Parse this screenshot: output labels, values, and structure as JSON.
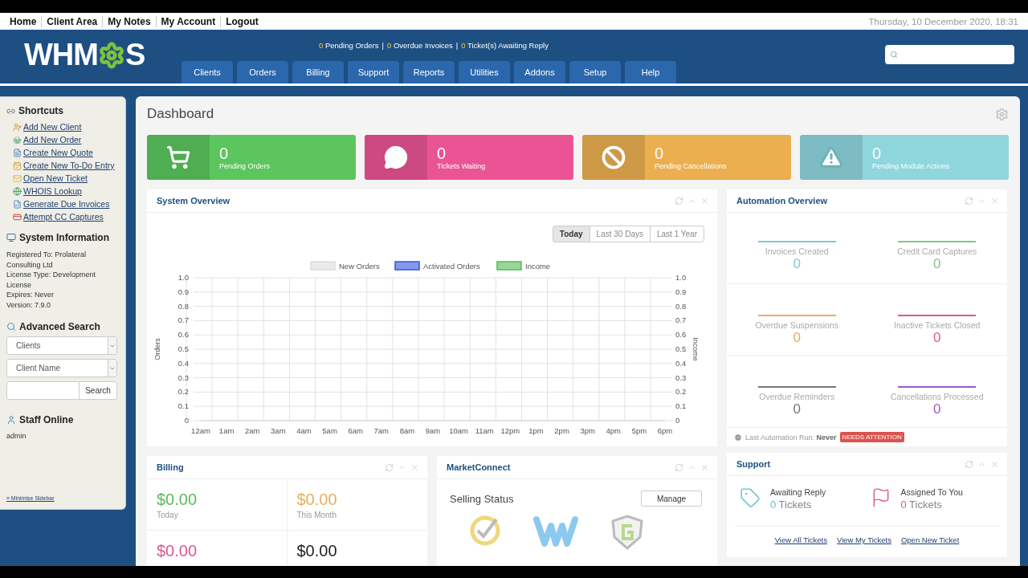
{
  "top_nav": {
    "links": [
      {
        "label": "Home"
      },
      {
        "label": "Client Area"
      },
      {
        "label": "My Notes"
      },
      {
        "label": "My Account"
      },
      {
        "label": "Logout"
      }
    ],
    "datetime": "Thursday, 10 December 2020, 18:31"
  },
  "header": {
    "logo_start": "WHM",
    "logo_end": "S",
    "alert_separator": "|",
    "alerts": [
      {
        "count": "0",
        "label": "Pending Orders"
      },
      {
        "count": "0",
        "label": "Overdue Invoices"
      },
      {
        "count": "0",
        "label": "Ticket(s) Awaiting Reply"
      }
    ],
    "tabs": [
      {
        "label": "Clients",
        "selected": false
      },
      {
        "label": "Orders",
        "selected": false
      },
      {
        "label": "Billing",
        "selected": false
      },
      {
        "label": "Support",
        "selected": false
      },
      {
        "label": "Reports",
        "selected": false
      },
      {
        "label": "Utilities",
        "selected": false
      },
      {
        "label": "Addons",
        "selected": false
      },
      {
        "label": "Setup",
        "selected": false
      },
      {
        "label": "Help",
        "selected": false
      }
    ]
  },
  "sidebar": {
    "shortcuts": {
      "title": "Shortcuts",
      "items": [
        {
          "label": "Add New Client"
        },
        {
          "label": "Add New Order"
        },
        {
          "label": "Create New Quote"
        },
        {
          "label": "Create New To-Do Entry"
        },
        {
          "label": "Open New Ticket"
        },
        {
          "label": "WHOIS Lookup"
        },
        {
          "label": "Generate Due Invoices"
        },
        {
          "label": "Attempt CC Captures"
        }
      ]
    },
    "system_information": {
      "title": "System Information",
      "lines": [
        "Registered To: Prolateral",
        "Consulting Ltd",
        "License Type: Development",
        "License",
        "Expires: Never",
        "Version: 7.9.0"
      ]
    },
    "advanced_search": {
      "title": "Advanced Search",
      "type_select": "Clients",
      "field_select": "Client Name",
      "button": "Search"
    },
    "staff_online": {
      "title": "Staff Online",
      "users": [
        "admin"
      ]
    },
    "minimise": "« Minimise Sidebar"
  },
  "dashboard": {
    "title": "Dashboard",
    "stats": [
      {
        "kind": "cart",
        "value": "0",
        "label": "Pending Orders",
        "color": "#5cc55e"
      },
      {
        "kind": "chat",
        "value": "0",
        "label": "Tickets Waiting",
        "color": "#ea5494"
      },
      {
        "kind": "ban",
        "value": "0",
        "label": "Pending Cancellations",
        "color": "#ebaf50"
      },
      {
        "kind": "warning",
        "value": "0",
        "label": "Pending Module Actions",
        "color": "#8fd6dd"
      }
    ],
    "system_overview": {
      "title": "System Overview",
      "ranges": [
        {
          "label": "Today",
          "selected": true
        },
        {
          "label": "Last 30 Days",
          "selected": false
        },
        {
          "label": "Last 1 Year",
          "selected": false
        }
      ],
      "right_axis": {
        "label": "Income",
        "ticks": [
          "1.0",
          "0.9",
          "0.8",
          "0.7",
          "0.6",
          "0.5",
          "0.4",
          "0.3",
          "0.2",
          "0.1",
          "0"
        ]
      },
      "chart_data": {
        "type": "line",
        "legend": "top",
        "ylabel": "Orders",
        "categories": [
          "12am",
          "1am",
          "2am",
          "3am",
          "4am",
          "5am",
          "6am",
          "7am",
          "8am",
          "9am",
          "10am",
          "11am",
          "12pm",
          "1pm",
          "2pm",
          "3pm",
          "4pm",
          "5pm",
          "6pm"
        ],
        "ylim": [
          0,
          1
        ],
        "yticks": [
          0,
          0.1,
          0.2,
          0.3,
          0.4,
          0.5,
          0.6,
          0.7,
          0.8,
          0.9,
          {
            "value": 1,
            "label": "1.0"
          }
        ],
        "series": [
          {
            "name": "New Orders",
            "color": "#dcdcdc",
            "values": [
              0,
              0,
              0,
              0,
              0,
              0,
              0,
              0,
              0,
              0,
              0,
              0,
              0,
              0,
              0,
              0,
              0,
              0,
              0
            ]
          },
          {
            "name": "Activated Orders",
            "color": "#3355dd",
            "values": [
              null,
              null,
              null,
              null,
              null,
              null,
              null,
              null,
              null,
              null,
              null,
              null,
              null,
              null,
              null,
              null,
              null,
              null,
              null
            ]
          },
          {
            "name": "Income",
            "color": "#55bb55",
            "values": [
              null,
              null,
              null,
              null,
              null,
              null,
              null,
              null,
              null,
              null,
              null,
              null,
              null,
              null,
              null,
              null,
              null,
              null,
              null
            ]
          }
        ]
      }
    },
    "automation_overview": {
      "title": "Automation Overview",
      "items": [
        {
          "label": "Invoices Created",
          "value": "0",
          "color": "#7ecbd3"
        },
        {
          "label": "Credit Card Captures",
          "value": "0",
          "color": "#82c785"
        },
        {
          "label": "Overdue Suspensions",
          "value": "0",
          "color": "#e9ae5c"
        },
        {
          "label": "Inactive Tickets Closed",
          "value": "0",
          "color": "#d9588c"
        },
        {
          "label": "Overdue Reminders",
          "value": "0",
          "color": "#777777"
        },
        {
          "label": "Cancellations Processed",
          "value": "0",
          "color": "#9b59c6"
        }
      ],
      "last_run_label": "Last Automation Run:",
      "last_run_value": "Never",
      "badge": "NEEDS ATTENTION"
    },
    "billing": {
      "title": "Billing",
      "items": [
        {
          "value": "$0.00",
          "label": "Today",
          "color": "#5cb85c"
        },
        {
          "value": "$0.00",
          "label": "This Month",
          "color": "#e9ae5c"
        },
        {
          "value": "$0.00",
          "color": "#d9588c"
        },
        {
          "value": "$0.00",
          "color": "#222222"
        }
      ]
    },
    "marketconnect": {
      "title": "MarketConnect",
      "heading": "Selling Status",
      "button": "Manage",
      "products": [
        {
          "kind": "ssl"
        },
        {
          "kind": "builder"
        },
        {
          "kind": "backup"
        }
      ]
    },
    "support": {
      "title": "Support",
      "items": [
        {
          "kind": "tag",
          "label": "Awaiting Reply",
          "value": "0 Tickets",
          "color": "#5bc0c8"
        },
        {
          "kind": "flag",
          "label": "Assigned To You",
          "value": "0 Tickets",
          "color": "#d9588c"
        }
      ],
      "links": [
        "View All Tickets",
        "View My Tickets",
        "Open New Ticket"
      ]
    }
  }
}
